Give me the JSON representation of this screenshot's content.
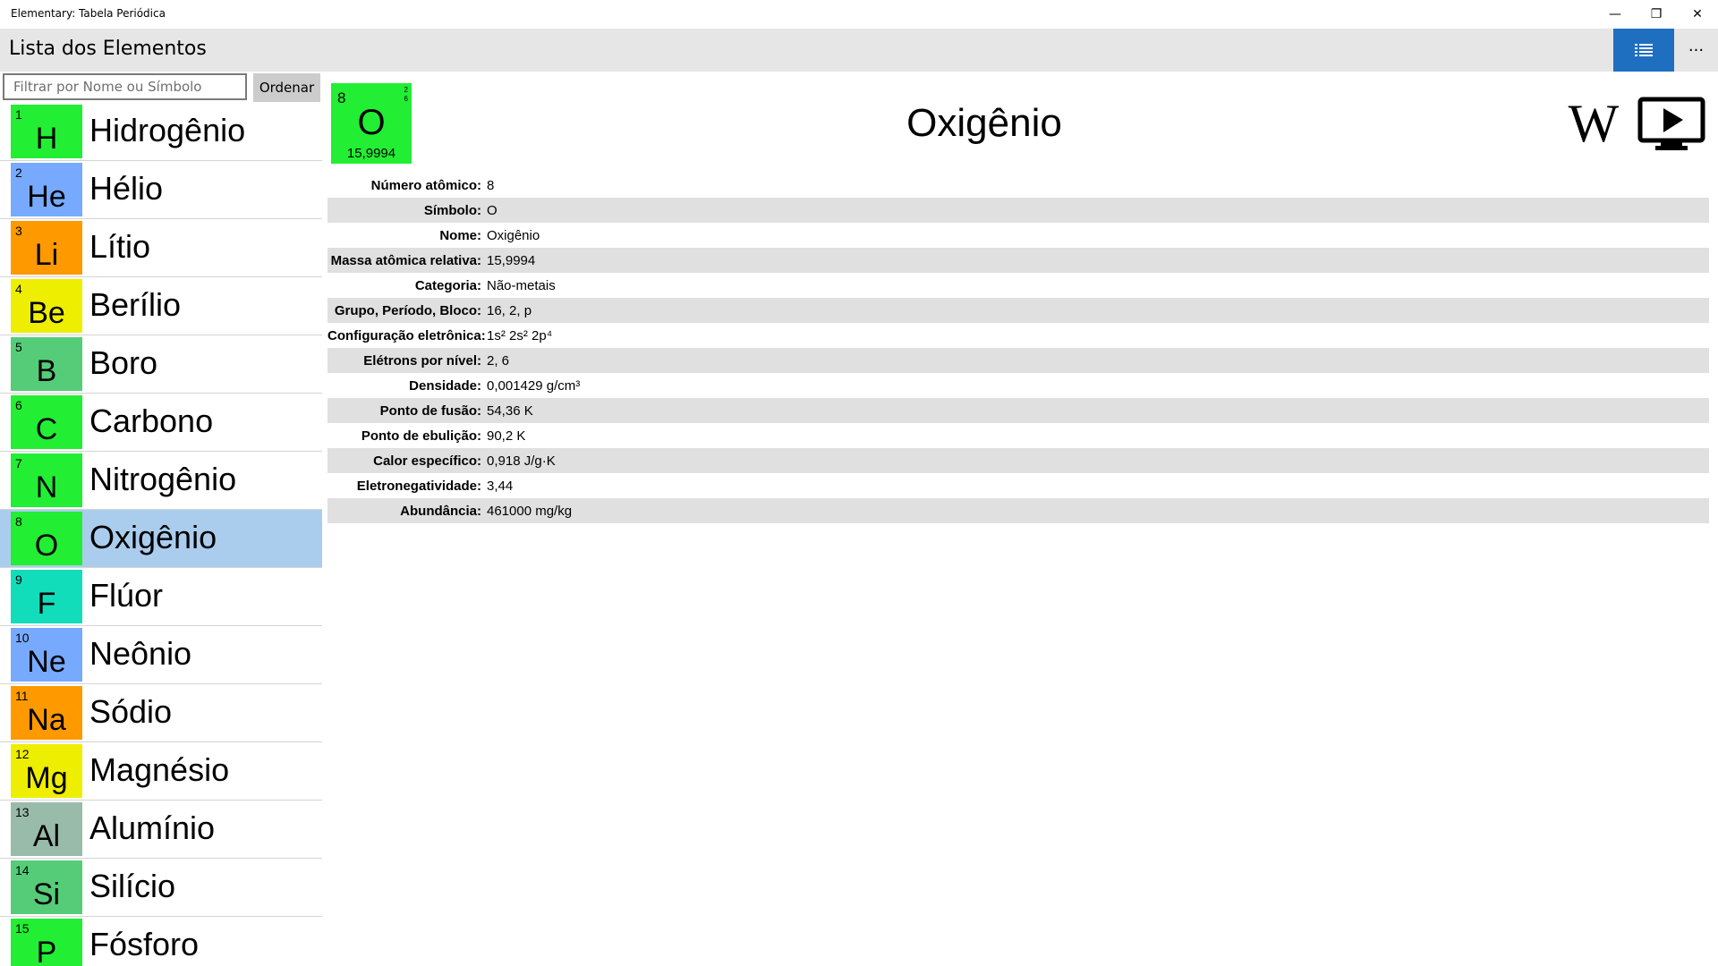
{
  "window": {
    "title": "Elementary: Tabela Periódica",
    "minimize": "—",
    "restore": "❐",
    "close": "✕"
  },
  "appbar": {
    "title": "Lista dos Elementos",
    "more": "···",
    "accent": "#1f6fc1"
  },
  "filter": {
    "placeholder": "Filtrar por Nome ou Símbolo",
    "value": "",
    "sort_label": "Ordenar"
  },
  "elements": [
    {
      "number": "1",
      "symbol": "H",
      "name": "Hidrogênio",
      "color": "#22ee33"
    },
    {
      "number": "2",
      "symbol": "He",
      "name": "Hélio",
      "color": "#77aaff"
    },
    {
      "number": "3",
      "symbol": "Li",
      "name": "Lítio",
      "color": "#ff9900"
    },
    {
      "number": "4",
      "symbol": "Be",
      "name": "Berílio",
      "color": "#eeee00"
    },
    {
      "number": "5",
      "symbol": "B",
      "name": "Boro",
      "color": "#55cc77"
    },
    {
      "number": "6",
      "symbol": "C",
      "name": "Carbono",
      "color": "#22ee33"
    },
    {
      "number": "7",
      "symbol": "N",
      "name": "Nitrogênio",
      "color": "#22ee33"
    },
    {
      "number": "8",
      "symbol": "O",
      "name": "Oxigênio",
      "color": "#22ee33",
      "selected": true
    },
    {
      "number": "9",
      "symbol": "F",
      "name": "Flúor",
      "color": "#11ddbb"
    },
    {
      "number": "10",
      "symbol": "Ne",
      "name": "Neônio",
      "color": "#77aaff"
    },
    {
      "number": "11",
      "symbol": "Na",
      "name": "Sódio",
      "color": "#ff9900"
    },
    {
      "number": "12",
      "symbol": "Mg",
      "name": "Magnésio",
      "color": "#eeee00"
    },
    {
      "number": "13",
      "symbol": "Al",
      "name": "Alumínio",
      "color": "#99bbaa"
    },
    {
      "number": "14",
      "symbol": "Si",
      "name": "Silício",
      "color": "#55cc77"
    },
    {
      "number": "15",
      "symbol": "P",
      "name": "Fósforo",
      "color": "#22ee33"
    }
  ],
  "selected": {
    "number": "8",
    "symbol": "O",
    "mass": "15,9994",
    "shells": [
      "2",
      "6"
    ],
    "name": "Oxigênio",
    "color": "#22ee33",
    "wiki_icon": "W",
    "properties": [
      {
        "label": "Número atômico:",
        "value": "8"
      },
      {
        "label": "Símbolo:",
        "value": "O"
      },
      {
        "label": "Nome:",
        "value": "Oxigênio"
      },
      {
        "label": "Massa atômica relativa:",
        "value": "15,9994"
      },
      {
        "label": "Categoria:",
        "value": "Não-metais"
      },
      {
        "label": "Grupo, Período, Bloco:",
        "value": "16, 2, p"
      },
      {
        "label": "Configuração eletrônica:",
        "value": "1s² 2s² 2p⁴"
      },
      {
        "label": "Elétrons por nível:",
        "value": "2, 6"
      },
      {
        "label": "Densidade:",
        "value": "0,001429 g/cm³"
      },
      {
        "label": "Ponto de fusão:",
        "value": "54,36 K"
      },
      {
        "label": "Ponto de ebulição:",
        "value": "90,2 K"
      },
      {
        "label": "Calor específico:",
        "value": "0,918 J/g·K"
      },
      {
        "label": "Eletronegatividade:",
        "value": "3,44"
      },
      {
        "label": "Abundância:",
        "value": "461000 mg/kg"
      }
    ]
  }
}
